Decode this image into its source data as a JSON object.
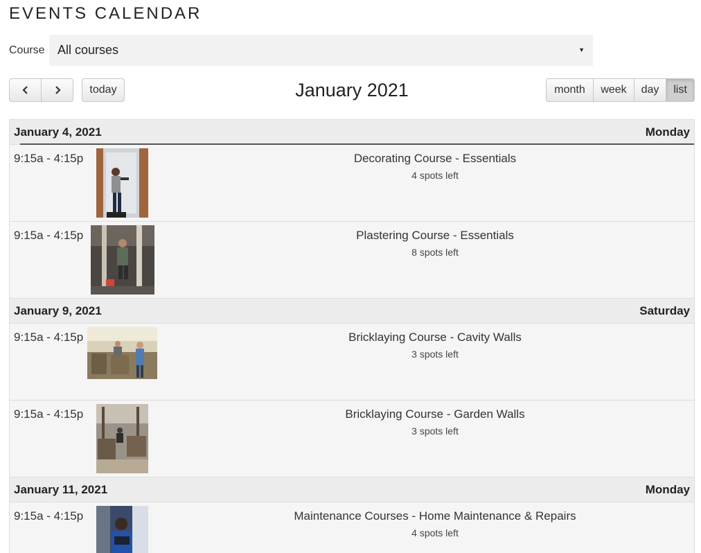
{
  "page": {
    "title": "EVENTS CALENDAR"
  },
  "filter": {
    "label": "Course",
    "selected": "All courses"
  },
  "toolbar": {
    "prev_icon": "chevron-left-icon",
    "next_icon": "chevron-right-icon",
    "today": "today",
    "title": "January 2021",
    "views": {
      "month": "month",
      "week": "week",
      "day": "day",
      "list": "list"
    },
    "active_view": "list"
  },
  "days": [
    {
      "date": "January 4, 2021",
      "weekday": "Monday",
      "events": [
        {
          "time": "9:15a - 4:15p",
          "title": "Decorating Course - Essentials",
          "spots": "4 spots left"
        },
        {
          "time": "9:15a - 4:15p",
          "title": "Plastering Course - Essentials",
          "spots": "8 spots left"
        }
      ]
    },
    {
      "date": "January 9, 2021",
      "weekday": "Saturday",
      "events": [
        {
          "time": "9:15a - 4:15p",
          "title": "Bricklaying Course - Cavity Walls",
          "spots": "3 spots left"
        },
        {
          "time": "9:15a - 4:15p",
          "title": "Bricklaying Course - Garden Walls",
          "spots": "3 spots left"
        }
      ]
    },
    {
      "date": "January 11, 2021",
      "weekday": "Monday",
      "events": [
        {
          "time": "9:15a - 4:15p",
          "title": "Maintenance Courses - Home Maintenance & Repairs",
          "spots": "4 spots left"
        }
      ]
    }
  ],
  "colors": {
    "header_bg": "#ececec",
    "row_bg": "#f5f5f5",
    "active_button": "#cfcfcf"
  }
}
